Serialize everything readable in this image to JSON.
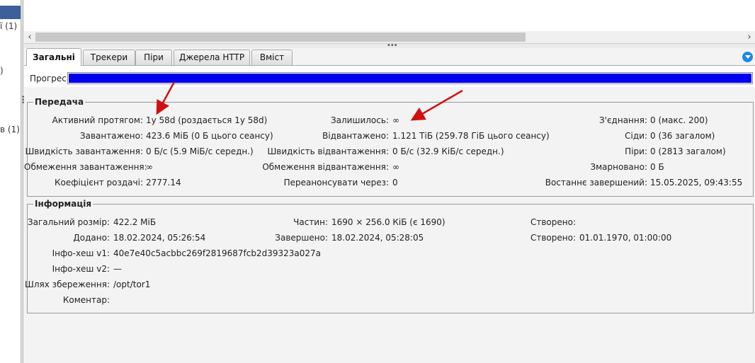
{
  "left_fragments": [
    "ї (1)",
    ")",
    "в (1)"
  ],
  "tabs": [
    {
      "label": "Загальні",
      "active": true
    },
    {
      "label": "Трекери",
      "active": false
    },
    {
      "label": "Піри",
      "active": false
    },
    {
      "label": "Джерела HTTP",
      "active": false
    },
    {
      "label": "Вміст",
      "active": false
    }
  ],
  "progress": {
    "label": "Прогрес:",
    "value": 1.0
  },
  "transfer": {
    "title": "Передача",
    "col1": [
      {
        "label": "Активний протягом:",
        "value": "1y 58d (роздається 1y 58d)"
      },
      {
        "label": "Завантажено:",
        "value": "423.6 МіБ (0 Б цього сеансу)"
      },
      {
        "label": "Швидкість завантаження:",
        "value": "0 Б/с (5.9 МіБ/с середн.)"
      },
      {
        "label": "Обмеження завантаження:",
        "value": "∞"
      },
      {
        "label": "Коефіцієнт роздачі:",
        "value": "2777.14"
      }
    ],
    "col2": [
      {
        "label": "Залишилось:",
        "value": "∞"
      },
      {
        "label": "Відвантажено:",
        "value": "1.121 ТіБ (259.78 ГіБ цього сеансу)"
      },
      {
        "label": "Швидкість відвантаження:",
        "value": "0 Б/с (32.9 КіБ/с середн.)"
      },
      {
        "label": "Обмеження відвантаження:",
        "value": "∞"
      },
      {
        "label": "Переанонсувати через:",
        "value": "0"
      }
    ],
    "col3": [
      {
        "label": "З'єднання:",
        "value": "0 (макс. 200)"
      },
      {
        "label": "Сіди:",
        "value": "0 (36 загалом)"
      },
      {
        "label": "Піри:",
        "value": "0 (2813 загалом)"
      },
      {
        "label": "Змарновано:",
        "value": "0 Б"
      },
      {
        "label": "Востаннє завершений:",
        "value": "15.05.2025, 09:43:55"
      }
    ]
  },
  "info": {
    "title": "Інформація",
    "rows": [
      {
        "label": "Загальний розмір:",
        "value": "422.2 МіБ"
      },
      {
        "label": "Додано:",
        "value": "18.02.2024, 05:26:54"
      },
      {
        "label": "Інфо-хеш v1:",
        "value": "40e7e40c5acbbc269f2819687fcb2d39323a027a"
      },
      {
        "label": "Інфо-хеш v2:",
        "value": "—"
      },
      {
        "label": "Шлях збереження:",
        "value": "/opt/tor1"
      },
      {
        "label": "Коментар:",
        "value": ""
      }
    ],
    "mid": [
      {
        "label": "Частин:",
        "value": "1690 × 256.0 КіБ (є 1690)"
      },
      {
        "label": "Завершено:",
        "value": "18.02.2024, 05:28:05"
      }
    ],
    "right": [
      {
        "label": "Створено:",
        "value": ""
      },
      {
        "label": "Створено:",
        "value": "01.01.1970, 01:00:00"
      }
    ]
  },
  "colors": {
    "progress": "#0000ee",
    "arrow": "#d01010",
    "tab_menu": "#1e88e5"
  }
}
